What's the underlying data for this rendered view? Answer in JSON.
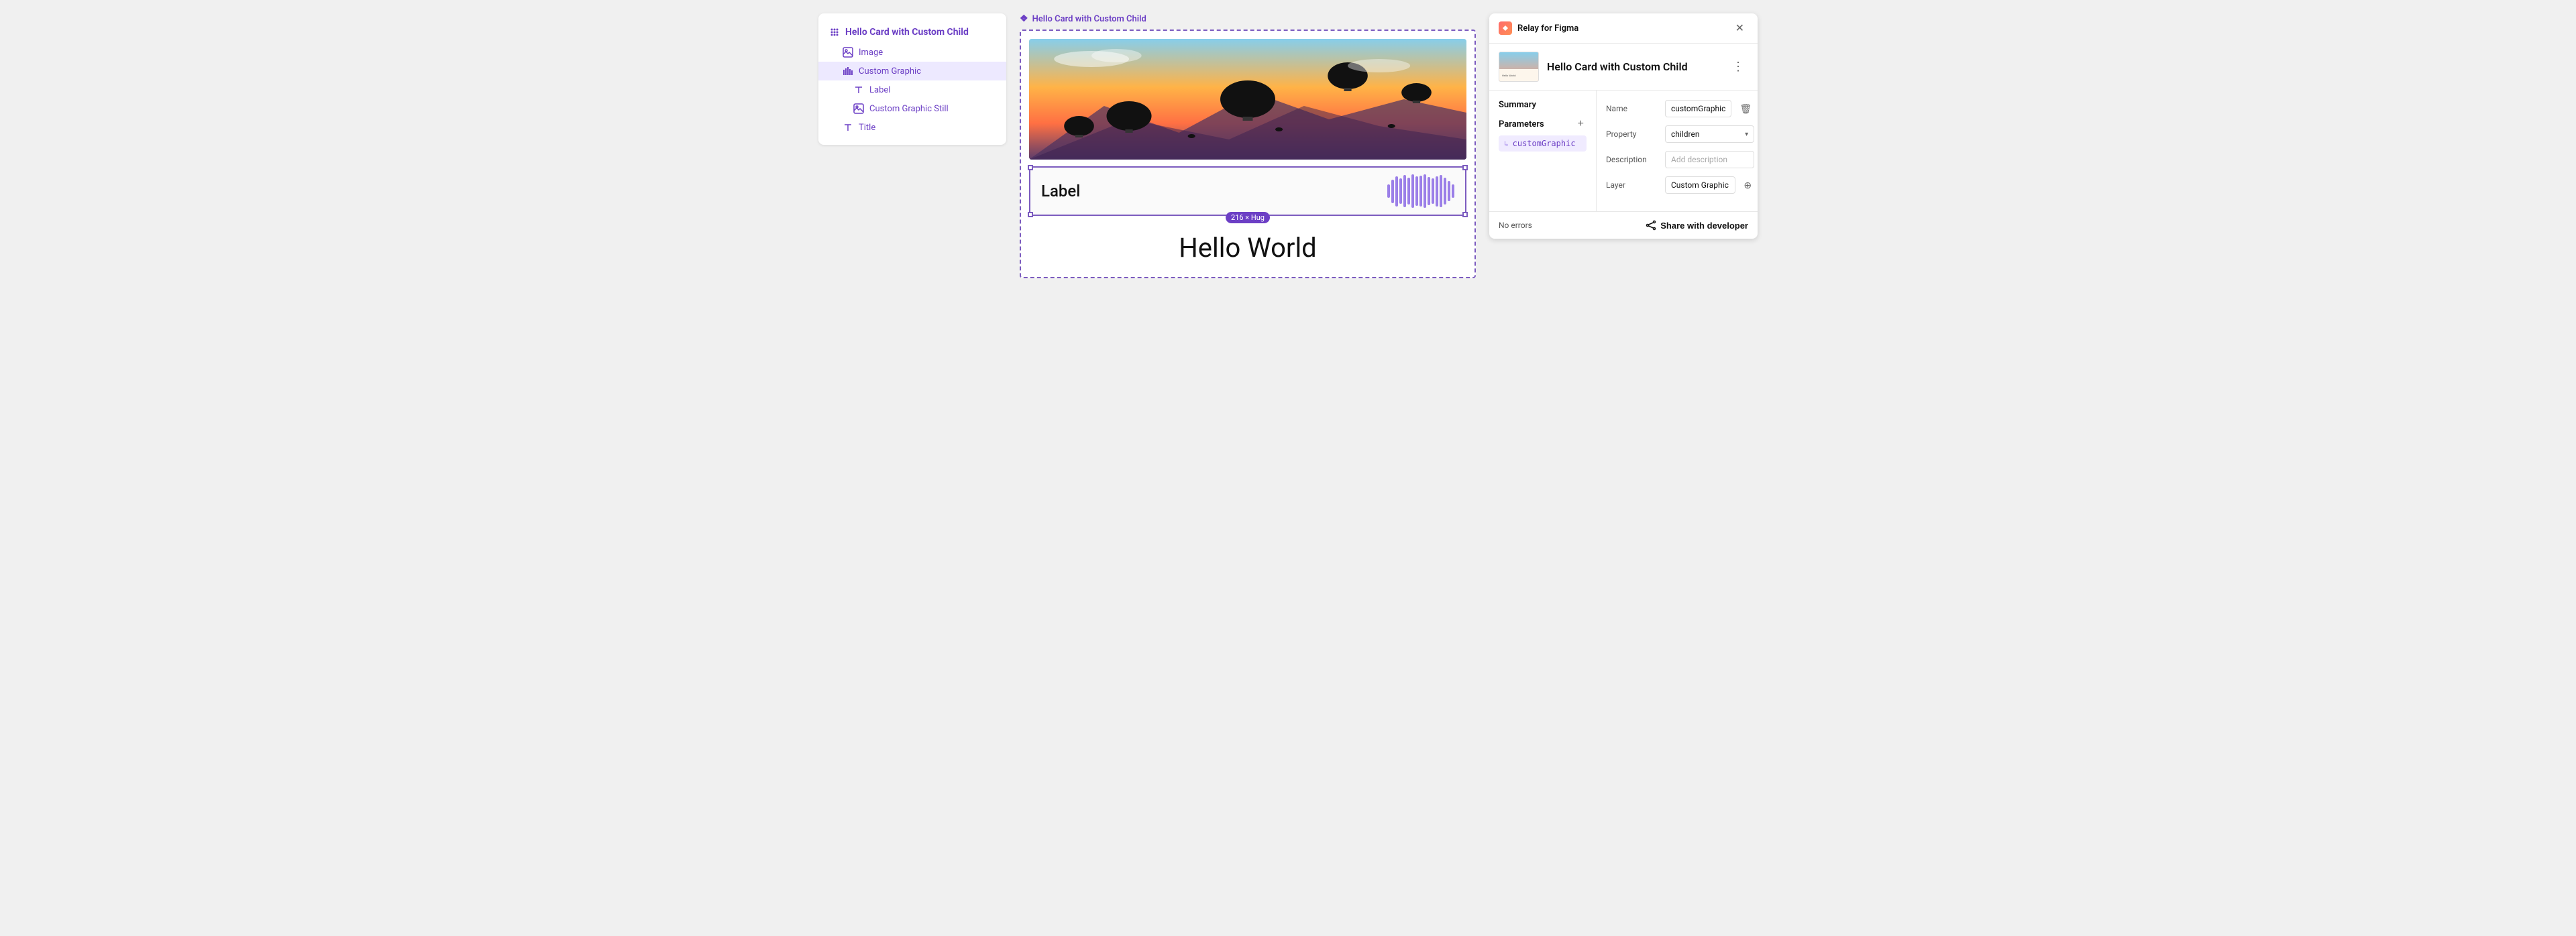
{
  "leftPanel": {
    "items": [
      {
        "id": "root",
        "label": "Hello Card with Custom Child",
        "icon": "grid-icon",
        "level": "root"
      },
      {
        "id": "image",
        "label": "Image",
        "icon": "image-icon",
        "level": "child1"
      },
      {
        "id": "customgraphic",
        "label": "Custom Graphic",
        "icon": "bar-chart-icon",
        "level": "child1",
        "active": true
      },
      {
        "id": "label",
        "label": "Label",
        "icon": "text-icon",
        "level": "child2"
      },
      {
        "id": "customgraphicstill",
        "label": "Custom Graphic Still",
        "icon": "image-icon",
        "level": "child2"
      },
      {
        "id": "title",
        "label": "Title",
        "icon": "text-icon",
        "level": "child1"
      }
    ]
  },
  "canvas": {
    "title": "Hello Card with Custom Child",
    "graphicLabel": "Label",
    "sizeBadge": "216 × Hug",
    "helloWorldText": "Hello World"
  },
  "rightPanel": {
    "appName": "Relay for Figma",
    "cardTitle": "Hello Card with Custom Child",
    "summaryLabel": "Summary",
    "parametersLabel": "Parameters",
    "paramName": "customGraphic",
    "fields": {
      "nameLabel": "Name",
      "nameValue": "customGraphic",
      "propertyLabel": "Property",
      "propertyValue": "children",
      "descriptionLabel": "Description",
      "descriptionPlaceholder": "Add description",
      "layerLabel": "Layer",
      "layerValue": "Custom Graphic"
    },
    "trashIcon": "🗑",
    "footer": {
      "noErrors": "No errors",
      "shareLabel": "Share with developer"
    }
  }
}
